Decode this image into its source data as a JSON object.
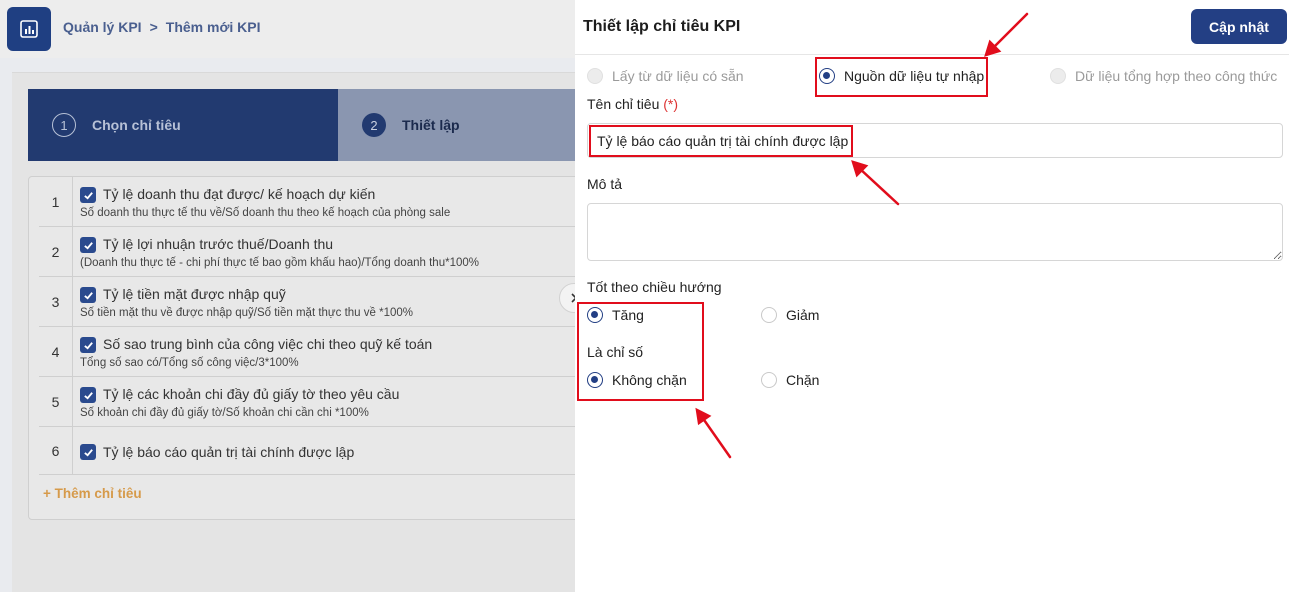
{
  "breadcrumb": {
    "root": "Quản lý KPI",
    "separator": ">",
    "current": "Thêm mới KPI"
  },
  "steps": [
    {
      "number": "1",
      "label": "Chọn chỉ tiêu"
    },
    {
      "number": "2",
      "label": "Thiết lập"
    }
  ],
  "kpi_list": [
    {
      "index": "1",
      "title": "Tỷ lệ doanh thu đạt được/ kế hoạch dự kiến",
      "formula": "Số doanh thu thực tế thu về/Số doanh thu theo kế hoạch của phòng sale"
    },
    {
      "index": "2",
      "title": "Tỷ lệ lợi nhuận trước thuế/Doanh thu",
      "formula": "(Doanh thu thực tế - chi phí thực tế bao gồm khấu hao)/Tổng doanh thu*100%"
    },
    {
      "index": "3",
      "title": "Tỷ lệ tiền mặt được nhập quỹ",
      "formula": "Số tiền mặt thu về được nhập quỹ/Số tiền mặt thực thu về *100%"
    },
    {
      "index": "4",
      "title": "Số sao trung bình của công việc chi theo quỹ kế toán",
      "formula": "Tổng số sao có/Tổng số công việc/3*100%"
    },
    {
      "index": "5",
      "title": "Tỷ lệ các khoản chi đầy đủ giấy tờ theo yêu cầu",
      "formula": "Số khoản chi đầy đủ giấy tờ/Số khoản chi cần chi *100%"
    },
    {
      "index": "6",
      "title": "Tỷ lệ báo cáo quản trị tài chính được lập",
      "formula": ""
    }
  ],
  "add_kpi_label": "+ Thêm chỉ tiêu",
  "drawer": {
    "title": "Thiết lập chỉ tiêu KPI",
    "update_label": "Cập nhật",
    "source_options": [
      {
        "label": "Lấy từ dữ liệu có sẵn",
        "state": "disabled"
      },
      {
        "label": "Nguồn dữ liệu tự nhập",
        "state": "checked"
      },
      {
        "label": "Dữ liệu tổng hợp theo công thức",
        "state": "disabled"
      }
    ],
    "name_label": "Tên chỉ tiêu",
    "required_mark": "(*)",
    "name_value": "Tỷ lệ báo cáo quản trị tài chính được lập",
    "description_label": "Mô tả",
    "description_value": "",
    "direction_label": "Tốt theo chiều hướng",
    "direction_options": [
      {
        "label": "Tăng",
        "state": "checked"
      },
      {
        "label": "Giảm",
        "state": "unchecked"
      }
    ],
    "index_label": "Là chỉ số",
    "index_options": [
      {
        "label": "Không chặn",
        "state": "checked"
      },
      {
        "label": "Chặn",
        "state": "unchecked"
      }
    ]
  },
  "colors": {
    "primary": "#233f84",
    "annotation": "#e10d1c",
    "accent_orange": "#d69a4a"
  }
}
